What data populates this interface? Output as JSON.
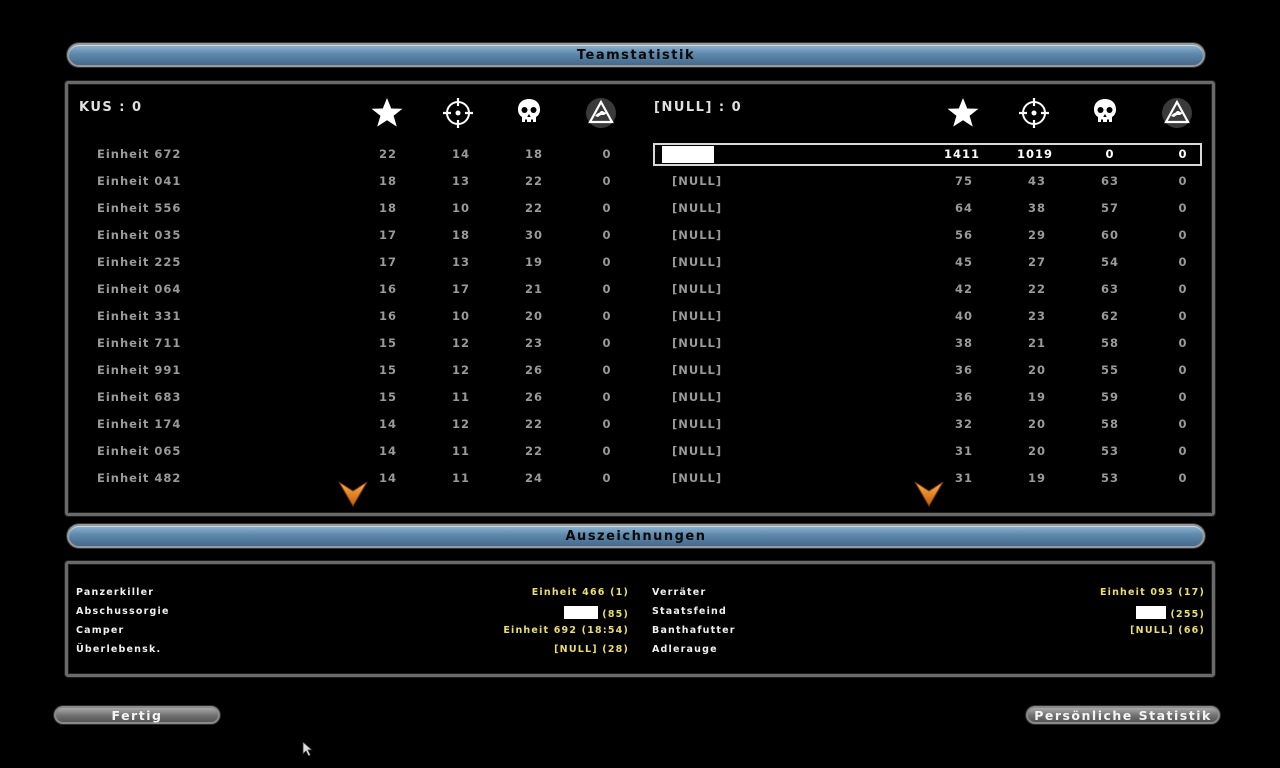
{
  "team_stats": {
    "title": "Teamstatistik",
    "teams": [
      {
        "name": "KUS : 0",
        "icon_names": [
          "star-icon",
          "crosshair-icon",
          "skull-icon",
          "vehicle-kill-icon"
        ],
        "rows": [
          {
            "name": "Einheit 672",
            "v": [
              "22",
              "14",
              "18",
              "0"
            ]
          },
          {
            "name": "Einheit 041",
            "v": [
              "18",
              "13",
              "22",
              "0"
            ]
          },
          {
            "name": "Einheit 556",
            "v": [
              "18",
              "10",
              "22",
              "0"
            ]
          },
          {
            "name": "Einheit 035",
            "v": [
              "17",
              "18",
              "30",
              "0"
            ]
          },
          {
            "name": "Einheit 225",
            "v": [
              "17",
              "13",
              "19",
              "0"
            ]
          },
          {
            "name": "Einheit 064",
            "v": [
              "16",
              "17",
              "21",
              "0"
            ]
          },
          {
            "name": "Einheit 331",
            "v": [
              "16",
              "10",
              "20",
              "0"
            ]
          },
          {
            "name": "Einheit 711",
            "v": [
              "15",
              "12",
              "23",
              "0"
            ]
          },
          {
            "name": "Einheit 991",
            "v": [
              "15",
              "12",
              "26",
              "0"
            ]
          },
          {
            "name": "Einheit 683",
            "v": [
              "15",
              "11",
              "26",
              "0"
            ]
          },
          {
            "name": "Einheit 174",
            "v": [
              "14",
              "12",
              "22",
              "0"
            ]
          },
          {
            "name": "Einheit 065",
            "v": [
              "14",
              "11",
              "22",
              "0"
            ]
          },
          {
            "name": "Einheit 482",
            "v": [
              "14",
              "11",
              "24",
              "0"
            ]
          }
        ]
      },
      {
        "name": "[NULL] : 0",
        "icon_names": [
          "star-icon",
          "crosshair-icon",
          "skull-icon",
          "vehicle-kill-icon"
        ],
        "highlight": {
          "v": [
            "1411",
            "1019",
            "0",
            "0"
          ]
        },
        "rows": [
          {
            "name": "[NULL]",
            "v": [
              "75",
              "43",
              "63",
              "0"
            ]
          },
          {
            "name": "[NULL]",
            "v": [
              "64",
              "38",
              "57",
              "0"
            ]
          },
          {
            "name": "[NULL]",
            "v": [
              "56",
              "29",
              "60",
              "0"
            ]
          },
          {
            "name": "[NULL]",
            "v": [
              "45",
              "27",
              "54",
              "0"
            ]
          },
          {
            "name": "[NULL]",
            "v": [
              "42",
              "22",
              "63",
              "0"
            ]
          },
          {
            "name": "[NULL]",
            "v": [
              "40",
              "23",
              "62",
              "0"
            ]
          },
          {
            "name": "[NULL]",
            "v": [
              "38",
              "21",
              "58",
              "0"
            ]
          },
          {
            "name": "[NULL]",
            "v": [
              "36",
              "20",
              "55",
              "0"
            ]
          },
          {
            "name": "[NULL]",
            "v": [
              "36",
              "19",
              "59",
              "0"
            ]
          },
          {
            "name": "[NULL]",
            "v": [
              "32",
              "20",
              "58",
              "0"
            ]
          },
          {
            "name": "[NULL]",
            "v": [
              "31",
              "20",
              "53",
              "0"
            ]
          },
          {
            "name": "[NULL]",
            "v": [
              "31",
              "19",
              "53",
              "0"
            ]
          }
        ]
      }
    ]
  },
  "awards": {
    "title": "Auszeichnungen",
    "left": [
      {
        "label": "Panzerkiller",
        "value": "Einheit 466 (1)"
      },
      {
        "label": "Abschussorgie",
        "value": "(85)",
        "redacted": true
      },
      {
        "label": "Camper",
        "value": "Einheit 692 (18:54)"
      },
      {
        "label": "Überlebensk.",
        "value": "[NULL] (28)"
      }
    ],
    "right": [
      {
        "label": "Verräter",
        "value": "Einheit 093 (17)"
      },
      {
        "label": "Staatsfeind",
        "value": "(255)",
        "redacted": true
      },
      {
        "label": "Banthafutter",
        "value": "[NULL] (66)"
      },
      {
        "label": "Adlerauge",
        "value": ""
      }
    ]
  },
  "buttons": {
    "done": "Fertig",
    "personal": "Persönliche Statistik"
  },
  "colors": {
    "accent_blue": "#5e88ab",
    "award_value": "#ecde6a",
    "row_text": "#9a9a9a"
  }
}
